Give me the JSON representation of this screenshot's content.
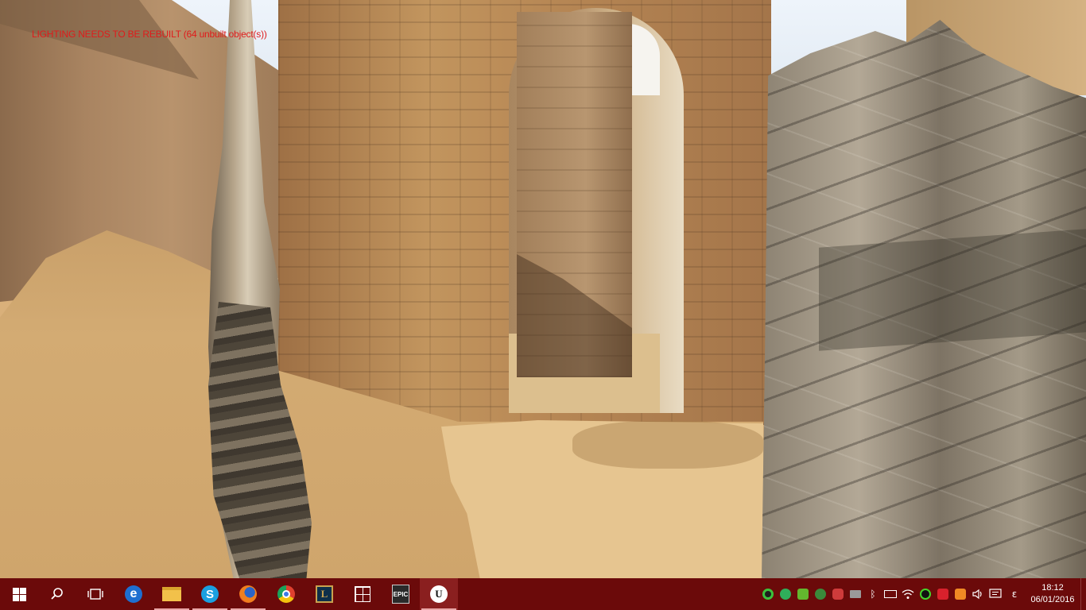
{
  "game": {
    "warning_text": "LIGHTING NEEDS TO BE REBUILT (64 unbuilt object(s))"
  },
  "taskbar": {
    "start_icon": "windows-start-icon",
    "search_icon": "search-icon",
    "task_view_icon": "task-view-icon",
    "pinned_apps": [
      {
        "name": "edge",
        "glyph": "e"
      },
      {
        "name": "file-explorer",
        "glyph": ""
      },
      {
        "name": "skype",
        "glyph": "S"
      },
      {
        "name": "firefox",
        "glyph": ""
      },
      {
        "name": "chrome",
        "glyph": ""
      },
      {
        "name": "league-of-legends",
        "glyph": "L"
      },
      {
        "name": "store",
        "glyph": ""
      },
      {
        "name": "epic-games-launcher",
        "glyph": "EPIC"
      },
      {
        "name": "unreal-engine",
        "glyph": "U"
      }
    ],
    "tray": {
      "language": "ε",
      "time": "18:12",
      "date": "06/01/2016"
    },
    "colors": {
      "taskbar_bg": "#6b0a0a",
      "active_bg": "#8a1f1f",
      "warning_text": "#e01b1b"
    }
  }
}
